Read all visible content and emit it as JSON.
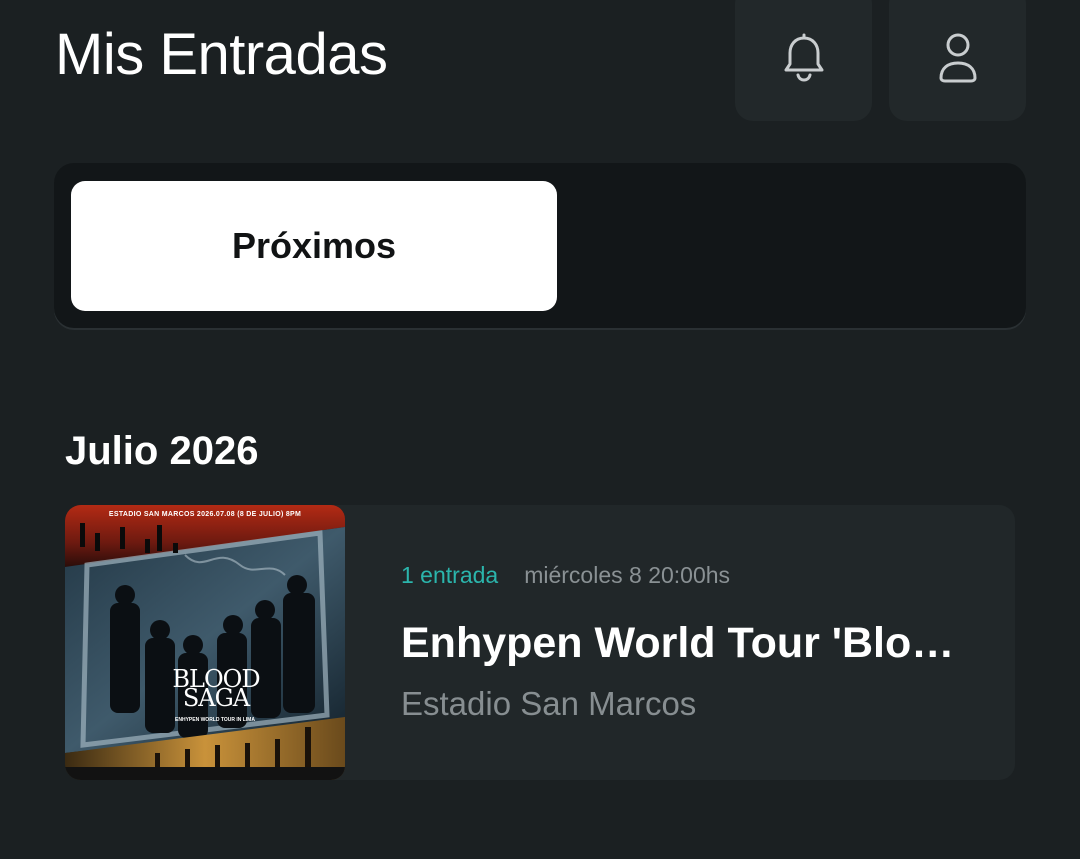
{
  "header": {
    "title": "Mis Entradas",
    "notifications_icon": "bell-icon",
    "profile_icon": "user-icon"
  },
  "tabs": [
    {
      "label": "Próximos",
      "active": true
    },
    {
      "label": "",
      "active": false
    }
  ],
  "sections": [
    {
      "title": "Julio 2026",
      "events": [
        {
          "ticket_count": "1 entrada",
          "date_time": "miércoles 8 20:00hs",
          "name": "Enhypen World Tour 'Blood Saga'",
          "venue": "Estadio San Marcos",
          "poster": {
            "header_text": "ESTADIO SAN MARCOS      2026.07.08 (8 DE JULIO) 8PM",
            "logo_line1": "BLOOD",
            "logo_line2": "SAGA",
            "subtitle": "ENHYPEN WORLD TOUR IN LIMA"
          }
        }
      ]
    }
  ],
  "colors": {
    "background": "#1b2022",
    "card": "#212729",
    "accent": "#2bb5ac",
    "muted": "#8a9194"
  }
}
